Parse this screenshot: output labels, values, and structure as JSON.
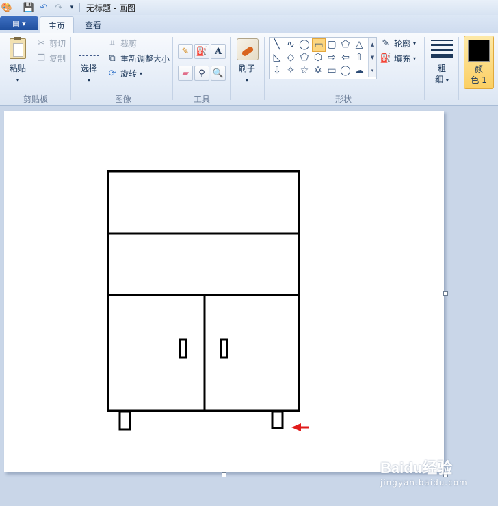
{
  "window": {
    "title": "无标题 - 画图"
  },
  "quick_access": {
    "icons": [
      "paint-app-icon",
      "save-icon",
      "undo-icon",
      "redo-icon",
      "customize-dropdown-icon"
    ]
  },
  "tabs": {
    "app_menu_icon": "▤ ▾",
    "home": "主页",
    "view": "查看"
  },
  "clipboard": {
    "paste": "粘贴",
    "cut": "剪切",
    "copy": "复制",
    "group": "剪贴板"
  },
  "image": {
    "select": "选择",
    "crop": "裁剪",
    "resize": "重新调整大小",
    "rotate": "旋转",
    "group": "图像"
  },
  "tools": {
    "group": "工具"
  },
  "brushes": {
    "label": "刷子"
  },
  "shapes": {
    "outline": "轮廓",
    "fill": "填充",
    "group": "形状",
    "gallery": [
      [
        "╲",
        "∿",
        "◯",
        "▭",
        "▢",
        "⬠",
        "△"
      ],
      [
        "◺",
        "◇",
        "⬠",
        "⬡",
        "⇨",
        "⇦",
        "⇧"
      ],
      [
        "⇩",
        "✧",
        "☆",
        "✡",
        "▭",
        "◯",
        "☁"
      ]
    ]
  },
  "size": {
    "label_line1": "粗",
    "label_line2": "细"
  },
  "color1": {
    "label_line1": "颜",
    "label_line2": "色 1",
    "value": "#000000"
  },
  "drawing": {
    "description_objects": [
      "cabinet",
      "arrow"
    ],
    "arrow_color": "#e11b1b"
  },
  "watermark": {
    "brand": "Baidu经验",
    "url": "jingyan.baidu.com"
  }
}
